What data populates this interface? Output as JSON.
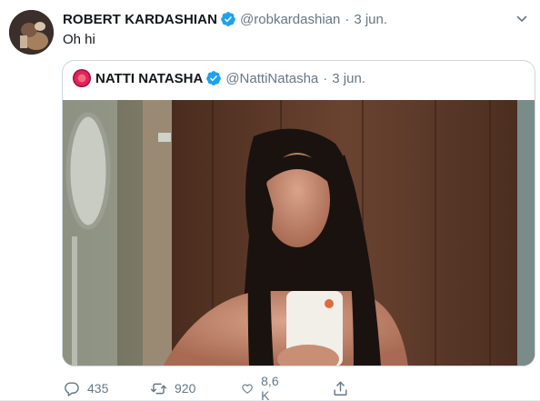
{
  "tweet": {
    "author_name": "ROBERT KARDASHIAN",
    "author_handle": "@robkardashian",
    "separator": "·",
    "date": "3 jun.",
    "text": "Oh hi",
    "quoted": {
      "author_name": "NATTI NATASHA",
      "author_handle": "@NattiNatasha",
      "separator": "·",
      "date": "3 jun."
    },
    "actions": {
      "replies": "435",
      "retweets": "920",
      "likes": "8,6 K"
    }
  },
  "colors": {
    "verified": "#1da1f2",
    "secondary_text": "#657786",
    "border": "#ccd6dd"
  },
  "icons": {
    "reply": "reply-icon",
    "retweet": "retweet-icon",
    "like": "heart-icon",
    "share": "share-icon",
    "verified": "verified-badge-icon",
    "caret": "chevron-down-icon"
  }
}
